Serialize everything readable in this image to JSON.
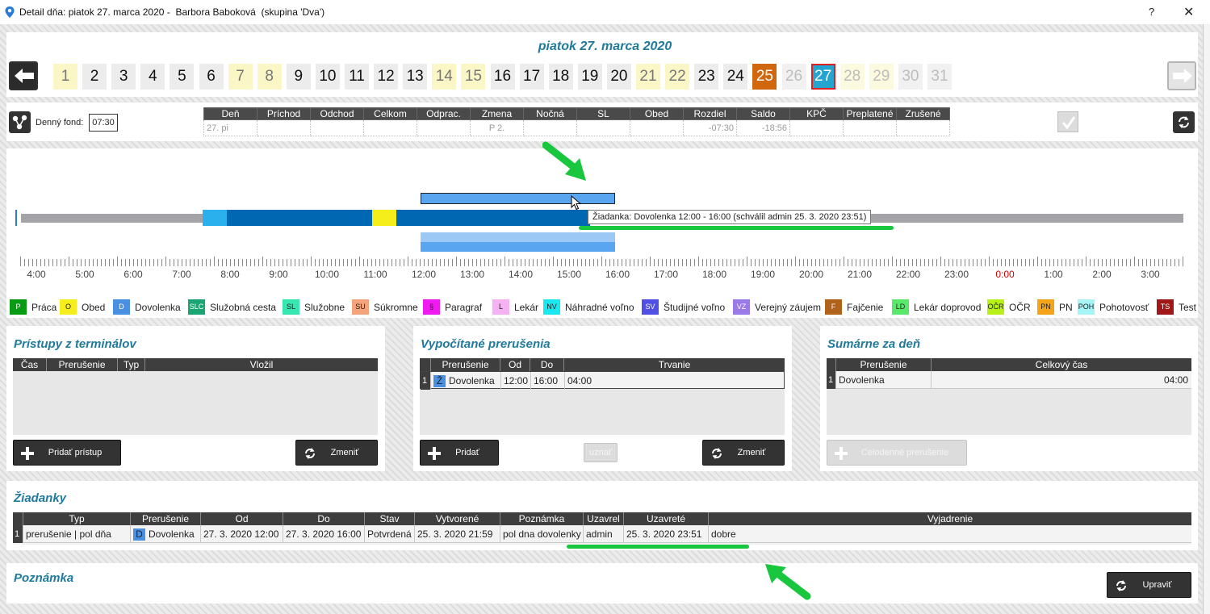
{
  "window": {
    "title": "Detail dňa: piatok 27. marca 2020 -  Barbora Baboková  (skupina 'Dva')",
    "help": "?",
    "close": "✕"
  },
  "calendar": {
    "date_title": "piatok 27. marca 2020",
    "days": [
      {
        "n": "1",
        "t": "w"
      },
      {
        "n": "2",
        "t": "d"
      },
      {
        "n": "3",
        "t": "d"
      },
      {
        "n": "4",
        "t": "d"
      },
      {
        "n": "5",
        "t": "d"
      },
      {
        "n": "6",
        "t": "d"
      },
      {
        "n": "7",
        "t": "w"
      },
      {
        "n": "8",
        "t": "w"
      },
      {
        "n": "9",
        "t": "d"
      },
      {
        "n": "10",
        "t": "d"
      },
      {
        "n": "11",
        "t": "d"
      },
      {
        "n": "12",
        "t": "d"
      },
      {
        "n": "13",
        "t": "d"
      },
      {
        "n": "14",
        "t": "w"
      },
      {
        "n": "15",
        "t": "w"
      },
      {
        "n": "16",
        "t": "d"
      },
      {
        "n": "17",
        "t": "d"
      },
      {
        "n": "18",
        "t": "d"
      },
      {
        "n": "19",
        "t": "d"
      },
      {
        "n": "20",
        "t": "d"
      },
      {
        "n": "21",
        "t": "w"
      },
      {
        "n": "22",
        "t": "w"
      },
      {
        "n": "23",
        "t": "d"
      },
      {
        "n": "24",
        "t": "d"
      },
      {
        "n": "25",
        "t": "o"
      },
      {
        "n": "26",
        "t": "f"
      },
      {
        "n": "27",
        "t": "s"
      },
      {
        "n": "28",
        "t": "h"
      },
      {
        "n": "29",
        "t": "h"
      },
      {
        "n": "30",
        "t": "f"
      },
      {
        "n": "31",
        "t": "f"
      }
    ]
  },
  "fund": {
    "label": "Denný fond:",
    "value": "07:30",
    "headers": [
      "Deň",
      "Príchod",
      "Odchod",
      "Celkom",
      "Odprac.",
      "Zmena",
      "Nočná",
      "SL",
      "Obed",
      "Rozdiel",
      "Saldo",
      "KPČ",
      "Preplatené",
      "Zrušené"
    ],
    "row": [
      "27. pi",
      "",
      "",
      "",
      "",
      "P 2.",
      "",
      "",
      "",
      "-07:30",
      "-18:56",
      "",
      "",
      ""
    ]
  },
  "timeline": {
    "tooltip": "Žiadanka: Dovolenka 12:00 - 16:00 (schválil admin 25. 3. 2020  23:51)",
    "hours": [
      "4:00",
      "5:00",
      "6:00",
      "7:00",
      "8:00",
      "9:00",
      "10:00",
      "11:00",
      "12:00",
      "13:00",
      "14:00",
      "15:00",
      "16:00",
      "17:00",
      "18:00",
      "19:00",
      "20:00",
      "21:00",
      "22:00",
      "23:00",
      "0:00",
      "1:00",
      "2:00",
      "3:00"
    ],
    "colors": {
      "shift_light": "#2ab0ec",
      "shift_dark": "#0067b3",
      "lunch": "#f6ee1a",
      "request": "#5aa5f0",
      "computed": "#5aa5f0",
      "base": "#a3a3a8"
    }
  },
  "legend": [
    {
      "code": "P",
      "label": "Práca",
      "bg": "#0a9b14",
      "fg": "#fff"
    },
    {
      "code": "O",
      "label": "Obed",
      "bg": "#f6ee1a",
      "fg": "#222"
    },
    {
      "code": "D",
      "label": "Dovolenka",
      "bg": "#4a90e2",
      "fg": "#fff"
    },
    {
      "code": "SLC",
      "label": "Služobná cesta",
      "bg": "#1aa673",
      "fg": "#fff"
    },
    {
      "code": "SL",
      "label": "Služobne",
      "bg": "#36e8b0",
      "fg": "#222"
    },
    {
      "code": "SU",
      "label": "Súkromne",
      "bg": "#f5a37a",
      "fg": "#222"
    },
    {
      "code": "§",
      "label": "Paragraf",
      "bg": "#f019f0",
      "fg": "#222"
    },
    {
      "code": "L",
      "label": "Lekár",
      "bg": "#f4b2f2",
      "fg": "#222"
    },
    {
      "code": "NV",
      "label": "Náhradné voľno",
      "bg": "#19e8f0",
      "fg": "#222"
    },
    {
      "code": "SV",
      "label": "Študijné voľno",
      "bg": "#5050e6",
      "fg": "#fff"
    },
    {
      "code": "VZ",
      "label": "Verejný záujem",
      "bg": "#9a7ae6",
      "fg": "#fff"
    },
    {
      "code": "F",
      "label": "Fajčenie",
      "bg": "#b0611a",
      "fg": "#fff"
    },
    {
      "code": "LD",
      "label": "Lekár doprovod",
      "bg": "#59e86a",
      "fg": "#222"
    },
    {
      "code": "OČR",
      "label": "OČR",
      "bg": "#b8f019",
      "fg": "#222"
    },
    {
      "code": "PN",
      "label": "PN",
      "bg": "#f5a319",
      "fg": "#222"
    },
    {
      "code": "POH",
      "label": "Pohotovosť",
      "bg": "#a6f4f4",
      "fg": "#222"
    },
    {
      "code": "TS",
      "label": "Test",
      "bg": "#a01818",
      "fg": "#fff"
    }
  ],
  "terminal": {
    "title": "Prístupy z terminálov",
    "headers": [
      "Čas",
      "Prerušenie",
      "Typ",
      "Vložil"
    ],
    "add_label": "Pridať prístup",
    "change_label": "Zmeniť"
  },
  "computed": {
    "title": "Vypočítané prerušenia",
    "headers": [
      "Prerušenie",
      "Od",
      "Do",
      "Trvanie"
    ],
    "row": {
      "num": "1",
      "badge": "Ž",
      "name": "Dovolenka",
      "od": "12:00",
      "do": "16:00",
      "trvanie": "04:00"
    },
    "add_label": "Pridať",
    "accept_label": "uznať",
    "change_label": "Zmeniť"
  },
  "summary": {
    "title": "Sumárne za deň",
    "headers": [
      "Prerušenie",
      "Celkový čas"
    ],
    "row": {
      "num": "1",
      "name": "Dovolenka",
      "time": "04:00"
    },
    "fullday_label": "Celodenné prerušenie"
  },
  "requests": {
    "title": "Žiadanky",
    "headers": [
      "Typ",
      "Prerušenie",
      "Od",
      "Do",
      "Stav",
      "Vytvorené",
      "Poznámka",
      "Uzavrel",
      "Uzavreté",
      "Vyjadrenie"
    ],
    "row": {
      "num": "1",
      "typ": "prerušenie | pol dňa",
      "badge": "D",
      "prerusenie": "Dovolenka",
      "od": "27. 3. 2020 12:00",
      "do": "27. 3. 2020 16:00",
      "stav": "Potvrdená",
      "vytvorene": "25. 3. 2020  21:59",
      "poznamka": "pol dna dovolenky",
      "uzavrel": "admin",
      "uzavrete": "25. 3. 2020  23:51",
      "vyjadrenie": "dobre"
    }
  },
  "note": {
    "title": "Poznámka",
    "edit_label": "Upraviť"
  }
}
